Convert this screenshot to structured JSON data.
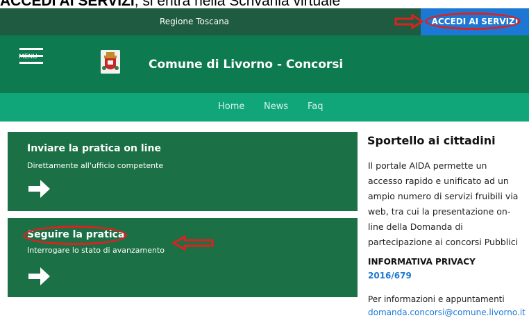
{
  "caption": {
    "bold": "ACCEDI AI SERVIZI",
    "rest": ", si entra nella Scrivania virtuale"
  },
  "topbar": {
    "region": "Regione Toscana",
    "access_button": "ACCEDI AI SERVIZI"
  },
  "header": {
    "menu_label": "MENU",
    "site_title": "Comune di Livorno - Concorsi"
  },
  "nav": {
    "items": [
      "Home",
      "News",
      "Faq"
    ]
  },
  "cards": [
    {
      "title": "Inviare la pratica on line",
      "subtitle": "Direttamente all'ufficio competente",
      "icon": "arrow-right-icon"
    },
    {
      "title": "Seguire la pratica",
      "subtitle": "Interrogare lo stato di avanzamento",
      "icon": "arrow-right-icon"
    }
  ],
  "sidebar": {
    "title": "Sportello ai cittadini",
    "text": "Il portale AIDA permette un accesso rapido e unificato ad un ampio numero di servizi fruibili via web, tra cui la presentazione on-line della Domanda di partecipazione ai concorsi Pubblici",
    "privacy_label": "INFORMATIVA PRIVACY",
    "privacy_year": "2016/679",
    "contacts": "Per informazioni e appuntamenti",
    "email": "domanda.concorsi@comune.livorno.it"
  },
  "colors": {
    "topbar": "#1f5b40",
    "header": "#0e7a4f",
    "nav": "#10a67a",
    "card": "#1b7045",
    "access": "#1c78d4",
    "annotation": "#e02020"
  }
}
